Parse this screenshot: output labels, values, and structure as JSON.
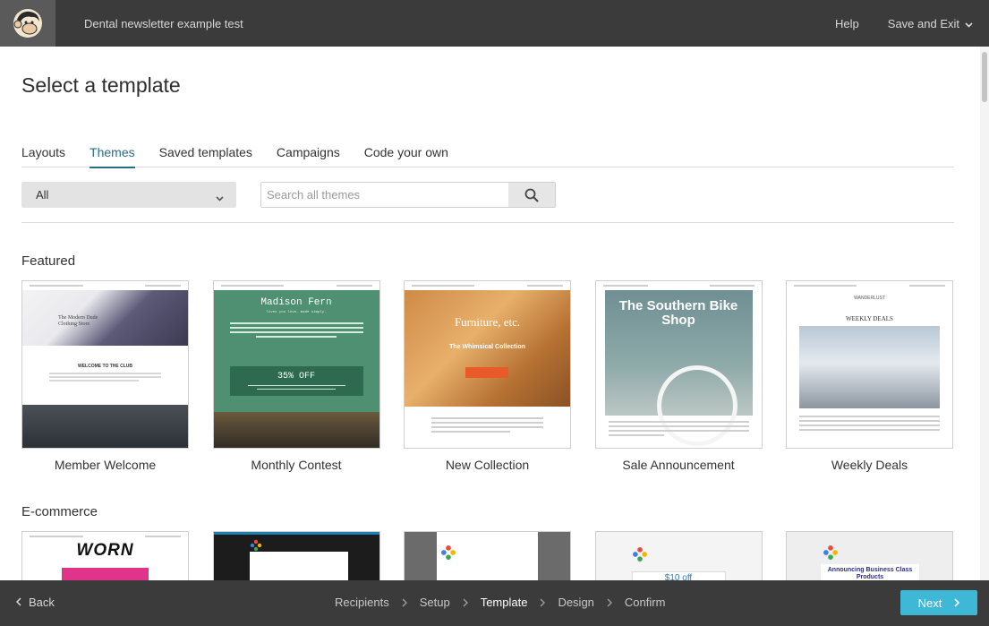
{
  "header": {
    "campaign_name": "Dental newsletter example test",
    "help_label": "Help",
    "save_exit_label": "Save and Exit"
  },
  "page": {
    "title": "Select a template"
  },
  "tabs": [
    {
      "label": "Layouts",
      "active": false
    },
    {
      "label": "Themes",
      "active": true
    },
    {
      "label": "Saved templates",
      "active": false
    },
    {
      "label": "Campaigns",
      "active": false
    },
    {
      "label": "Code your own",
      "active": false
    }
  ],
  "filter": {
    "selected": "All"
  },
  "search": {
    "placeholder": "Search all themes",
    "value": ""
  },
  "sections": {
    "featured": {
      "title": "Featured",
      "templates": [
        {
          "name": "Member Welcome",
          "thumb_text": {
            "title": "The Modern Dude Clothing Store",
            "heading": "WELCOME TO THE CLUB"
          }
        },
        {
          "name": "Monthly Contest",
          "thumb_text": {
            "title": "Madison Fern",
            "subtitle": "lives you love, made simply.",
            "offer": "35% OFF"
          }
        },
        {
          "name": "New Collection",
          "thumb_text": {
            "title": "Furniture, etc.",
            "subtitle": "The Whimsical Collection"
          }
        },
        {
          "name": "Sale Announcement",
          "thumb_text": {
            "title": "The Southern Bike Shop"
          }
        },
        {
          "name": "Weekly Deals",
          "thumb_text": {
            "brand": "WANDERLUST",
            "heading": "WEEKLY DEALS"
          }
        }
      ]
    },
    "ecommerce": {
      "title": "E-commerce",
      "templates": [
        {
          "thumb_text": {
            "title": "WORN"
          }
        },
        {
          "thumb_text": {}
        },
        {
          "thumb_text": {}
        },
        {
          "thumb_text": {
            "price": "$10 off"
          }
        },
        {
          "thumb_text": {
            "title": "Announcing Business Class Products"
          }
        }
      ]
    }
  },
  "footer": {
    "back_label": "Back",
    "steps": [
      {
        "label": "Recipients",
        "current": false
      },
      {
        "label": "Setup",
        "current": false
      },
      {
        "label": "Template",
        "current": true
      },
      {
        "label": "Design",
        "current": false
      },
      {
        "label": "Confirm",
        "current": false
      }
    ],
    "next_label": "Next"
  },
  "colors": {
    "topbar_bg": "#3b3b3b",
    "accent_tab": "#2a6d82",
    "next_button": "#3fb8d8"
  },
  "icons": {
    "logo": "chimp-logo-icon",
    "dropdown": "chevron-down-icon",
    "search": "search-icon",
    "back": "chevron-left-icon",
    "step_separator": "chevron-right-icon",
    "next": "chevron-right-icon"
  }
}
